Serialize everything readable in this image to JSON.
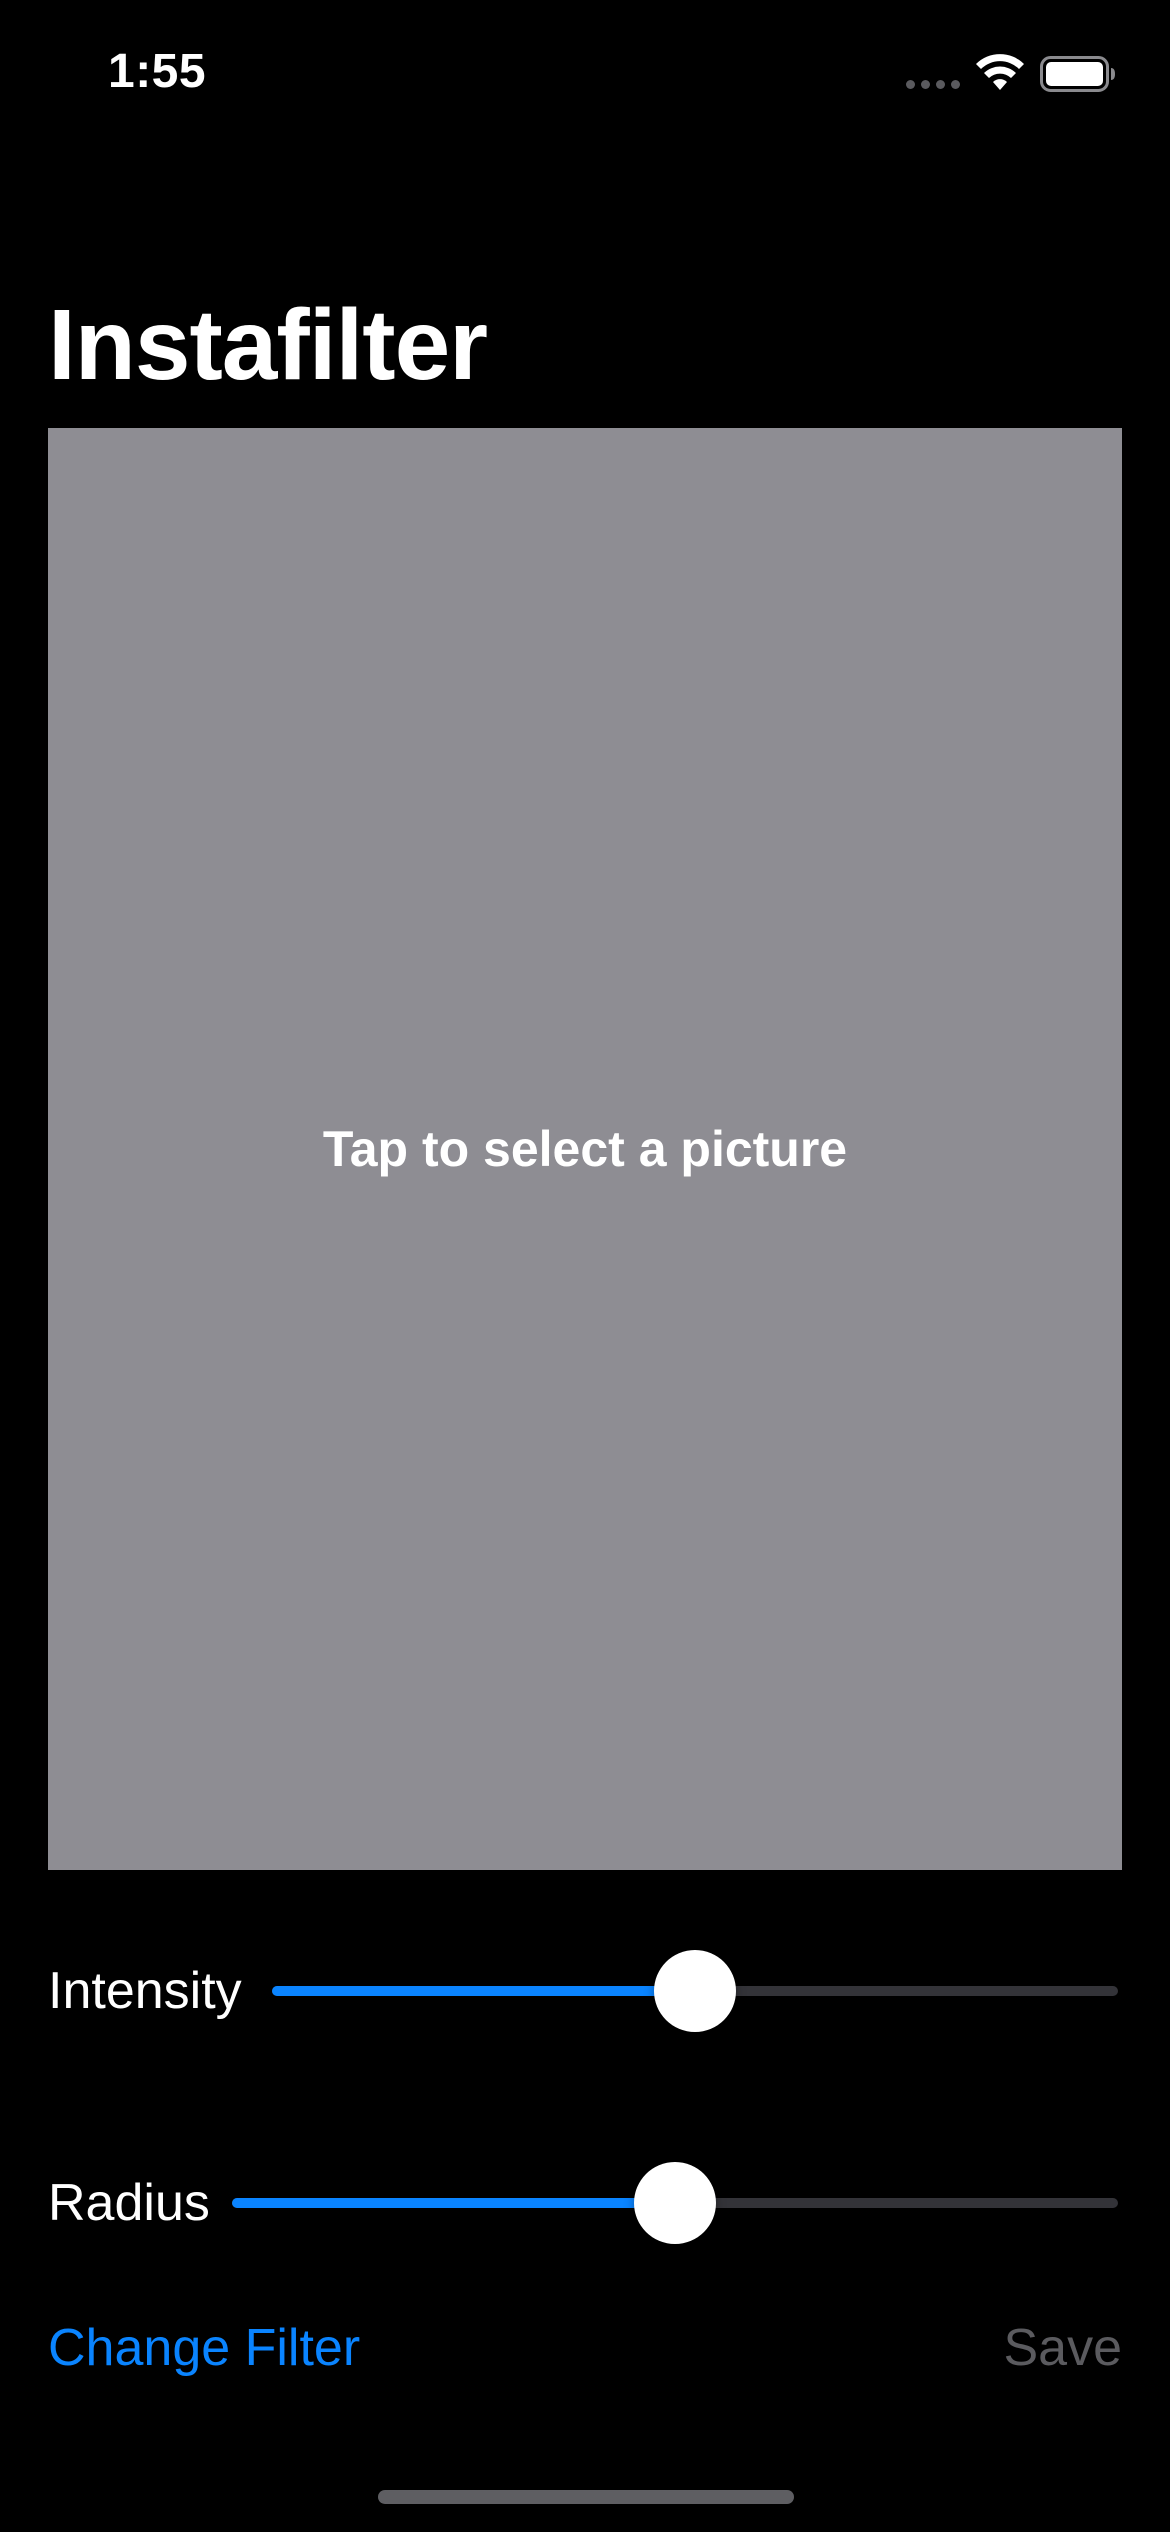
{
  "status_bar": {
    "time": "1:55",
    "icons": [
      "signal-dots-icon",
      "wifi-icon",
      "battery-icon"
    ]
  },
  "title": "Instafilter",
  "picture_area": {
    "prompt": "Tap to select a picture",
    "background_color": "#8e8d93"
  },
  "sliders": [
    {
      "label": "Intensity",
      "value": 0.5
    },
    {
      "label": "Radius",
      "value": 0.5
    }
  ],
  "toolbar": {
    "change_filter_label": "Change Filter",
    "save_label": "Save",
    "save_enabled": false
  },
  "colors": {
    "accent": "#0a84ff",
    "background": "#000000",
    "disabled": "#5b5b5f"
  }
}
